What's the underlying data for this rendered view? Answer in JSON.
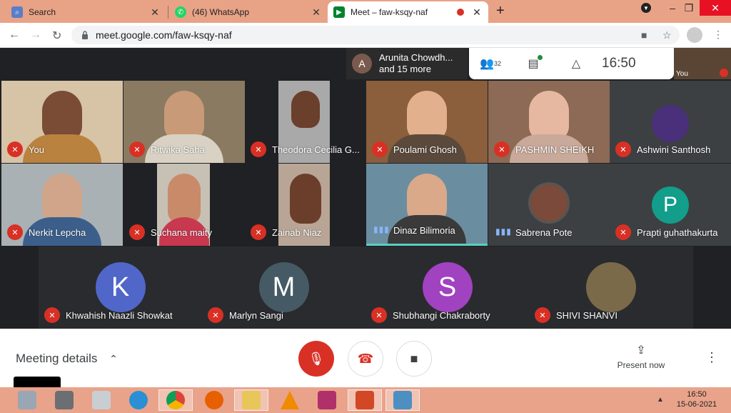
{
  "browser": {
    "tabs": [
      {
        "title": "Search",
        "icon": "search-icon",
        "close": "✕"
      },
      {
        "title": "(46) WhatsApp",
        "icon": "whatsapp-icon",
        "close": "✕"
      },
      {
        "title": "Meet – faw-ksqy-naf",
        "icon": "meet-icon",
        "close": "✕"
      }
    ],
    "new_tab": "+",
    "url": "meet.google.com/faw-ksqy-naf"
  },
  "meet": {
    "presenter_pill": {
      "initial": "A",
      "line1": "Arunita Chowdh...",
      "line2": "and 15 more"
    },
    "people_count": "32",
    "clock": "16:50",
    "self_label": "You",
    "tiles": [
      {
        "name": "You",
        "state": "muted"
      },
      {
        "name": "Ritwika Saha",
        "state": "muted"
      },
      {
        "name": "Theodora Cecilia G...",
        "state": "muted"
      },
      {
        "name": "Poulami Ghosh",
        "state": "muted"
      },
      {
        "name": "PASHMIN SHEIKH",
        "state": "muted"
      },
      {
        "name": "Ashwini Santhosh",
        "state": "muted"
      },
      {
        "name": "Nerkit Lepcha",
        "state": "muted"
      },
      {
        "name": "Suchana maity",
        "state": "muted"
      },
      {
        "name": "Zainab Niaz",
        "state": "muted"
      },
      {
        "name": "Dinaz Bilimoria",
        "state": "speaking"
      },
      {
        "name": "Sabrena Pote",
        "state": "speaking"
      },
      {
        "name": "Prapti guhathakurta",
        "state": "muted",
        "initial": "P"
      },
      {
        "name": "Khwahish Naazli Showkat",
        "state": "muted",
        "initial": "K"
      },
      {
        "name": "Marlyn Sangi",
        "state": "muted",
        "initial": "M"
      },
      {
        "name": "Shubhangi Chakraborty",
        "state": "muted",
        "initial": "S"
      },
      {
        "name": "SHIVI SHANVI",
        "state": "muted"
      }
    ],
    "meeting_details": "Meeting details",
    "present_now": "Present now"
  },
  "taskbar": {
    "time": "16:50",
    "date": "15-06-2021",
    "tray_arrow": "▲"
  },
  "colors": {
    "accent_red": "#d93025",
    "speaker_teal": "#58d0c0",
    "taskbar": "#e9a38a"
  }
}
